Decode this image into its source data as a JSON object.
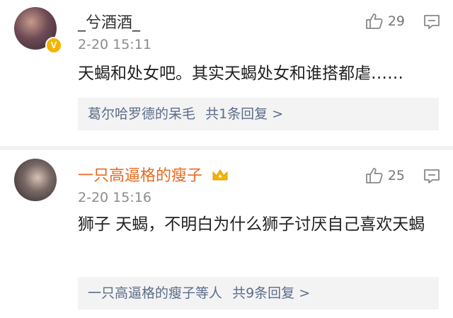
{
  "comments": [
    {
      "username": "_兮酒酒_",
      "time": "2-20 15:11",
      "likes": "29",
      "text": "天蝎和处女吧。其实天蝎处女和谁搭都虐……",
      "reply_preview": {
        "name": "葛尔哈罗德的呆毛",
        "count": "共1条回复 >"
      },
      "verified_badge": "V"
    },
    {
      "username": "一只高逼格的瘦子",
      "time": "2-20 15:16",
      "likes": "25",
      "text": "狮子 天蝎，不明白为什么狮子讨厌自己喜欢天蝎",
      "reply_preview": {
        "name": "一只高逼格的瘦子等人",
        "count": "共9条回复 >"
      },
      "username_color": "#e86a1f",
      "badge_icon": "crown-icon"
    }
  ]
}
